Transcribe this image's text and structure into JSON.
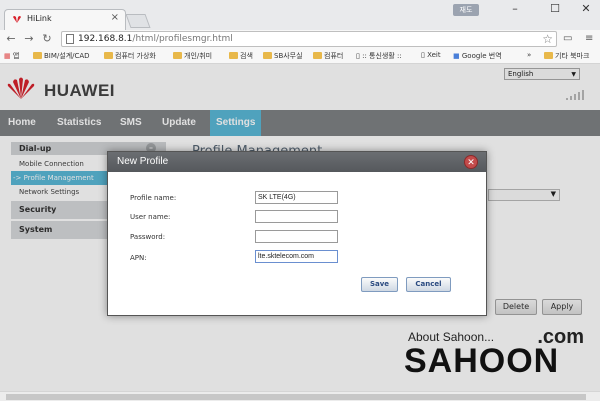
{
  "browser": {
    "tab_title": "HiLink",
    "tab_close": "×",
    "window_user": "재도",
    "win_min": "–",
    "win_max": "☐",
    "win_close": "✕",
    "url_host": "192.168.8.1",
    "url_path": "/html/profilesmgr.html",
    "bookmarks": [
      "앱",
      "BIM/설계/CAD",
      "컴퓨터 가상화",
      "개인/취미",
      "검색",
      "SB사무실",
      "컴퓨터",
      ":: 통신생활 ::",
      "Xeit",
      "Google 번역",
      "»",
      "기타 북마크"
    ]
  },
  "header": {
    "brand": "HUAWEI",
    "language": "English"
  },
  "mainnav": {
    "items": [
      "Home",
      "Statistics",
      "SMS",
      "Update",
      "Settings"
    ],
    "active": "Settings"
  },
  "leftmenu": {
    "dialup": "Dial-up",
    "dialup_toggle": "–",
    "mobile_connection": "Mobile Connection",
    "profile_management": "-> Profile Management",
    "network_settings": "Network Settings",
    "security": "Security",
    "system": "System"
  },
  "content": {
    "title": "Profile Management",
    "delete_label": "Delete",
    "apply_label": "Apply"
  },
  "dialog": {
    "title": "New Profile",
    "close_glyph": "✕",
    "profile_name_label": "Profile name:",
    "profile_name_value": "SK LTE(4G)",
    "user_name_label": "User name:",
    "user_name_value": "",
    "password_label": "Password:",
    "password_value": "",
    "apn_label": "APN:",
    "apn_value": "lte.sktelecom.com",
    "save_label": "Save",
    "cancel_label": "Cancel"
  },
  "watermark": {
    "top": "About Sahoon...",
    "com": ".com",
    "main": "SAHOON"
  },
  "colors": {
    "nav_bg": "#7f8285",
    "accent": "#5bb9d8",
    "dialog_header": "#5e6165",
    "close_red": "#c34b4b"
  }
}
